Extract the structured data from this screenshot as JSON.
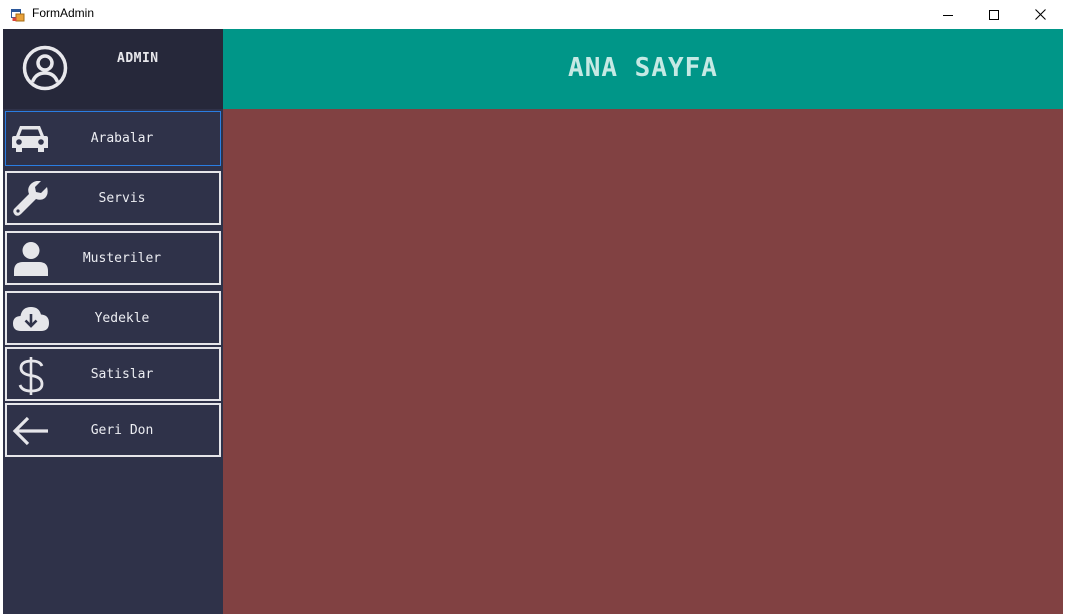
{
  "window": {
    "title": "FormAdmin"
  },
  "profile": {
    "user_label": "ADMIN",
    "icon": "user-circle-icon"
  },
  "menu": [
    {
      "label": "Arabalar",
      "icon": "car-icon",
      "active": true
    },
    {
      "label": "Servis",
      "icon": "wrench-icon",
      "active": false
    },
    {
      "label": "Musteriler",
      "icon": "user-icon",
      "active": false
    },
    {
      "label": "Yedekle",
      "icon": "cloud-download-icon",
      "active": false
    },
    {
      "label": "Satislar",
      "icon": "dollar-icon",
      "active": false
    },
    {
      "label": "Geri Don",
      "icon": "arrow-left-icon",
      "active": false
    }
  ],
  "header": {
    "title": "ANA SAYFA"
  },
  "colors": {
    "sidebar": "#2f3249",
    "profile_panel": "#26283a",
    "header": "#009688",
    "content": "#814142",
    "active_border": "#2a7de1"
  }
}
